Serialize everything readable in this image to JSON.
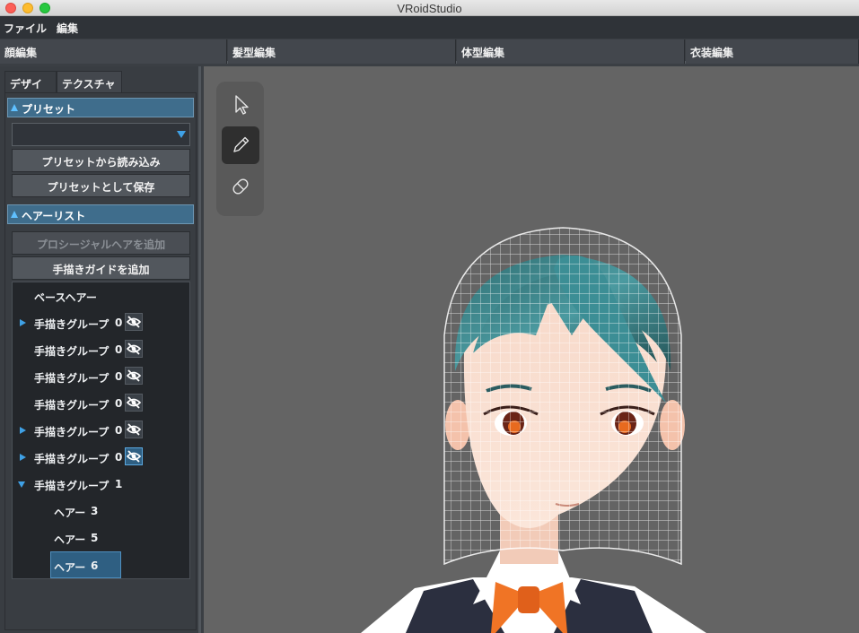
{
  "window": {
    "title": "VRoidStudio"
  },
  "menu": [
    "ファイル",
    "編集"
  ],
  "top_tabs": [
    "顔編集",
    "髪型編集",
    "体型編集",
    "衣装編集"
  ],
  "sub_tabs": [
    "デザイン",
    "テクスチャ"
  ],
  "preset": {
    "header": "プリセット",
    "dropdown_value": "",
    "load_button": "プリセットから読み込み",
    "save_button": "プリセットとして保存"
  },
  "hair_list": {
    "header": "ヘアーリスト",
    "add_procedural_button": "プロシージャルヘアを追加",
    "add_guide_button": "手描きガイドを追加",
    "items": [
      {
        "label": "ベースヘアー",
        "count": ""
      },
      {
        "label": "手描きグループ",
        "count": "0"
      },
      {
        "label": "手描きグループ",
        "count": "0"
      },
      {
        "label": "手描きグループ",
        "count": "0"
      },
      {
        "label": "手描きグループ",
        "count": "0"
      },
      {
        "label": "手描きグループ",
        "count": "0"
      },
      {
        "label": "手描きグループ",
        "count": "0"
      },
      {
        "label": "手描きグループ",
        "count": "1"
      },
      {
        "label": "ヘアー",
        "count": "3"
      },
      {
        "label": "ヘアー",
        "count": "5"
      },
      {
        "label": "ヘアー",
        "count": "6"
      }
    ]
  },
  "tools": [
    {
      "icon": "cursor-arrow-icon",
      "active": false
    },
    {
      "icon": "pencil-icon",
      "active": true
    },
    {
      "icon": "eraser-icon",
      "active": false
    }
  ],
  "colors": {
    "accent": "#3fa1e6",
    "section_header": "#3f6d8c",
    "viewport_bg": "#646464"
  }
}
